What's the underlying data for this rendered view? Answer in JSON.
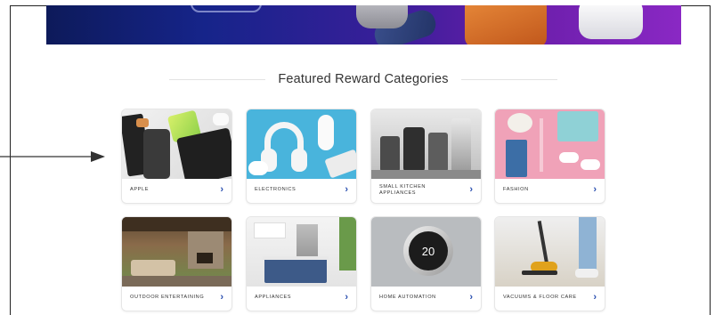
{
  "section": {
    "title": "Featured Reward Categories"
  },
  "categories": [
    {
      "label": "APPLE",
      "chevron": "›"
    },
    {
      "label": "ELECTRONICS",
      "chevron": "›"
    },
    {
      "label": "SMALL KITCHEN APPLIANCES",
      "chevron": "›"
    },
    {
      "label": "FASHION",
      "chevron": "›"
    },
    {
      "label": "OUTDOOR ENTERTAINING",
      "chevron": "›"
    },
    {
      "label": "APPLIANCES",
      "chevron": "›"
    },
    {
      "label": "HOME AUTOMATION",
      "chevron": "›"
    },
    {
      "label": "VACUUMS & FLOOR CARE",
      "chevron": "›"
    }
  ],
  "thermostat": {
    "value": "20"
  },
  "colors": {
    "accent": "#2a4fb0",
    "hero_start": "#0d1a5a",
    "hero_end": "#8a28c4"
  }
}
